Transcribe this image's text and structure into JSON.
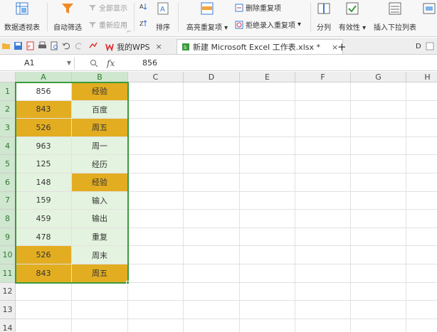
{
  "ribbon": {
    "pivot_table": "数据透视表",
    "auto_filter": "自动筛选",
    "show_all": "全部显示",
    "reapply": "重新应用",
    "sort": "排序",
    "highlight_dup": "高亮重复项",
    "delete_dup": "删除重复项",
    "reject_dup": "拒绝录入重复项",
    "split_column": "分列",
    "validity": "有效性",
    "insert_dropdown": "插入下拉列表",
    "group_symbol": "▾",
    "dialog_launcher": "⌐"
  },
  "tabs": [
    {
      "label": "我的WPS",
      "close": "×"
    },
    {
      "label": "新建 Microsoft Excel 工作表.xlsx *",
      "close": "×"
    }
  ],
  "new_tab": "+",
  "tabbar_right": "D",
  "formula_bar": {
    "name_box": "A1",
    "fx": "fx",
    "value": "856"
  },
  "columns": [
    "A",
    "B",
    "C",
    "D",
    "E",
    "F",
    "G",
    "H"
  ],
  "rows": [
    "1",
    "2",
    "3",
    "4",
    "5",
    "6",
    "7",
    "8",
    "9",
    "10",
    "11",
    "12",
    "13",
    "14"
  ],
  "table": [
    {
      "a": "856",
      "b": "经验",
      "a_fill": "white",
      "b_fill": "orange"
    },
    {
      "a": "843",
      "b": "百度",
      "a_fill": "orange",
      "b_fill": "green"
    },
    {
      "a": "526",
      "b": "周五",
      "a_fill": "orange",
      "b_fill": "orange"
    },
    {
      "a": "963",
      "b": "周一",
      "a_fill": "green",
      "b_fill": "green"
    },
    {
      "a": "125",
      "b": "经历",
      "a_fill": "green",
      "b_fill": "green"
    },
    {
      "a": "148",
      "b": "经验",
      "a_fill": "green",
      "b_fill": "orange"
    },
    {
      "a": "159",
      "b": "输入",
      "a_fill": "green",
      "b_fill": "green"
    },
    {
      "a": "459",
      "b": "输出",
      "a_fill": "green",
      "b_fill": "green"
    },
    {
      "a": "478",
      "b": "重复",
      "a_fill": "green",
      "b_fill": "green"
    },
    {
      "a": "526",
      "b": "周末",
      "a_fill": "orange",
      "b_fill": "green"
    },
    {
      "a": "843",
      "b": "周五",
      "a_fill": "orange",
      "b_fill": "orange"
    }
  ],
  "colors": {
    "duplicate_orange": "#e3ad21",
    "selection_green": "#e4f3df",
    "selection_border": "#3d9a3d"
  }
}
